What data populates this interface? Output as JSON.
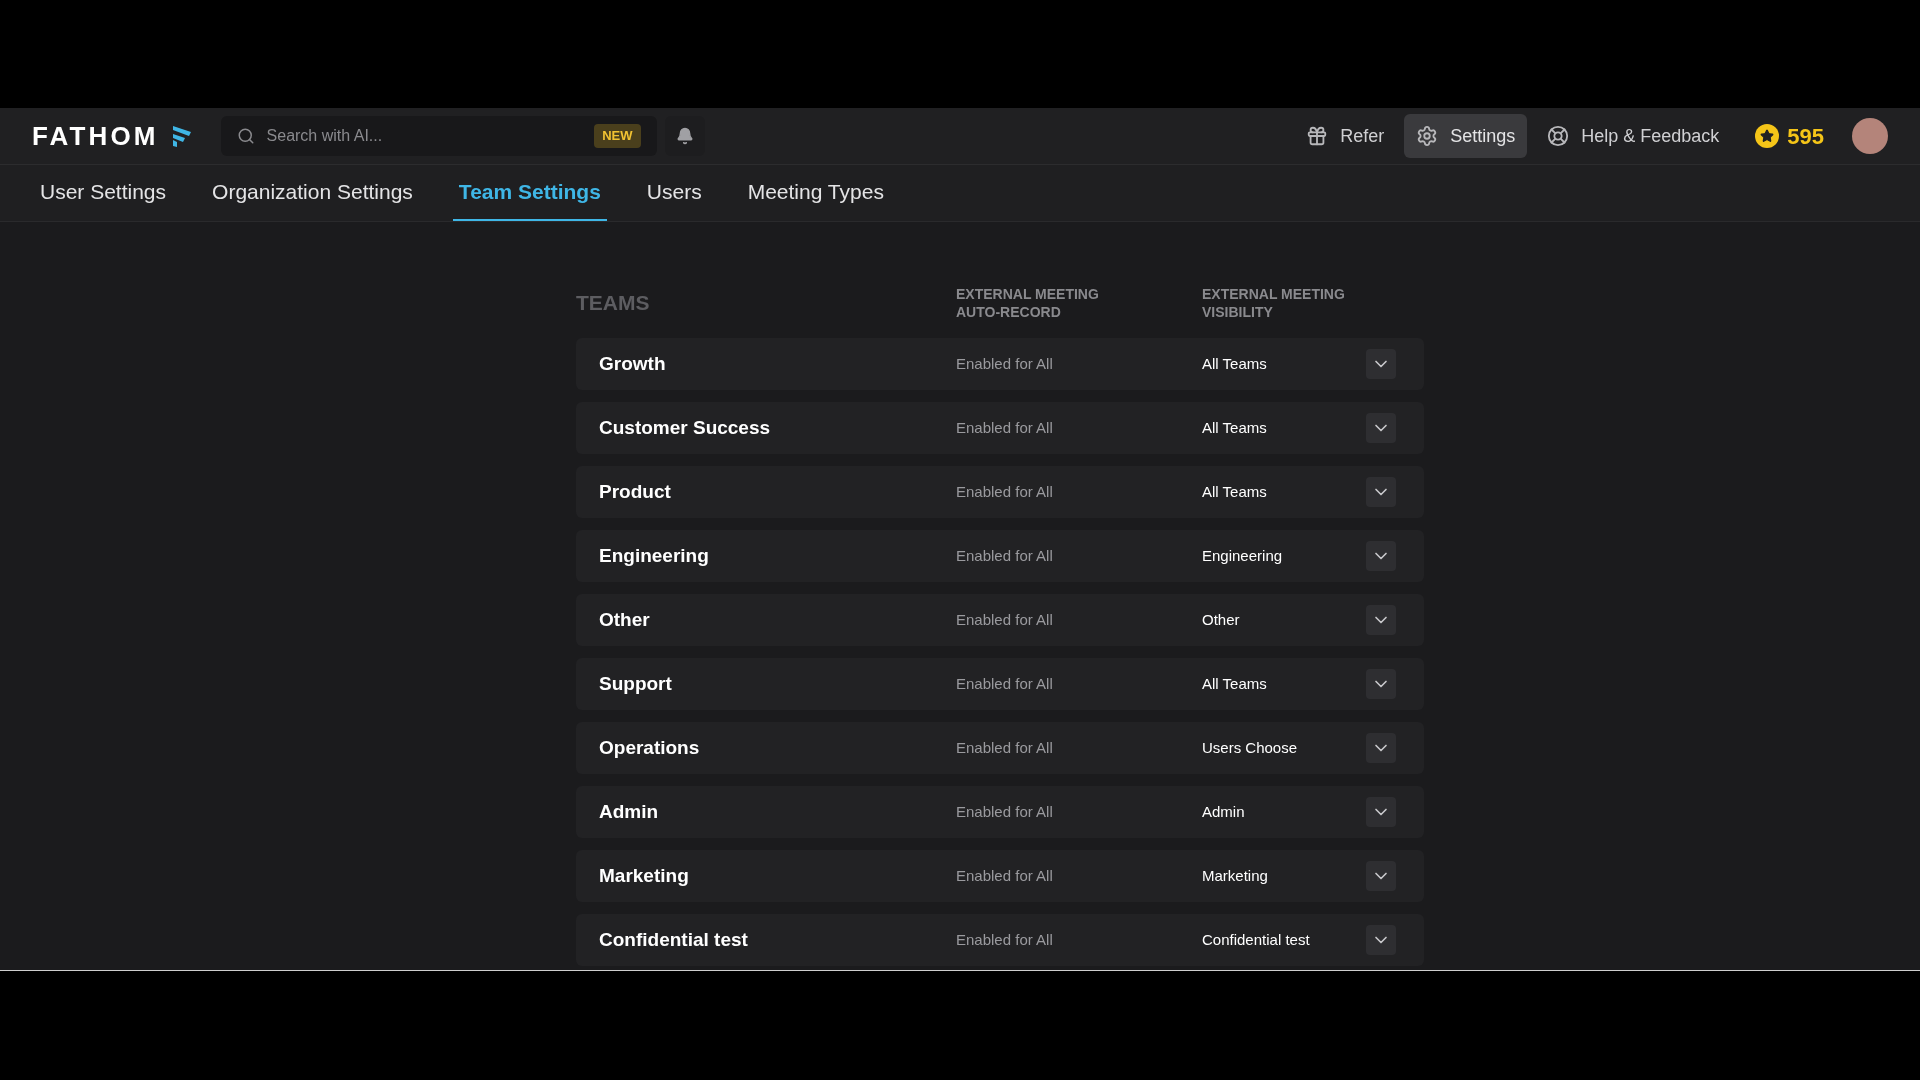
{
  "header": {
    "logo": "FATHOM",
    "search": {
      "placeholder": "Search with AI..."
    },
    "new_badge": "NEW",
    "actions": [
      {
        "kind": "refer",
        "label": "Refer",
        "selected": false
      },
      {
        "kind": "settings",
        "label": "Settings",
        "selected": true
      },
      {
        "kind": "help",
        "label": "Help & Feedback",
        "selected": false
      }
    ],
    "points": "595"
  },
  "tabs": [
    {
      "label": "User Settings",
      "selected": false
    },
    {
      "label": "Organization Settings",
      "selected": false
    },
    {
      "label": "Team Settings",
      "selected": true
    },
    {
      "label": "Users",
      "selected": false
    },
    {
      "label": "Meeting Types",
      "selected": false
    }
  ],
  "table": {
    "columns": [
      "TEAMS",
      "EXTERNAL MEETING AUTO-RECORD",
      "EXTERNAL MEETING VISIBILITY"
    ],
    "rows": [
      {
        "team": "Growth",
        "auto_record": "Enabled for All",
        "visibility": "All Teams"
      },
      {
        "team": "Customer Success",
        "auto_record": "Enabled for All",
        "visibility": "All Teams"
      },
      {
        "team": "Product",
        "auto_record": "Enabled for All",
        "visibility": "All Teams"
      },
      {
        "team": "Engineering",
        "auto_record": "Enabled for All",
        "visibility": "Engineering"
      },
      {
        "team": "Other",
        "auto_record": "Enabled for All",
        "visibility": "Other"
      },
      {
        "team": "Support",
        "auto_record": "Enabled for All",
        "visibility": "All Teams"
      },
      {
        "team": "Operations",
        "auto_record": "Enabled for All",
        "visibility": "Users Choose"
      },
      {
        "team": "Admin",
        "auto_record": "Enabled for All",
        "visibility": "Admin"
      },
      {
        "team": "Marketing",
        "auto_record": "Enabled for All",
        "visibility": "Marketing"
      },
      {
        "team": "Confidential test",
        "auto_record": "Enabled for All",
        "visibility": "Confidential test"
      }
    ]
  }
}
